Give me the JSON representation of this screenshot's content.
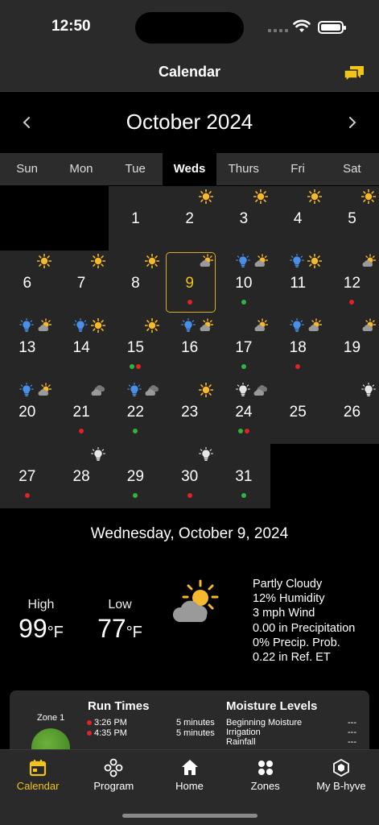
{
  "status_bar": {
    "time": "12:50"
  },
  "nav": {
    "title": "Calendar"
  },
  "calendar": {
    "month_label": "October 2024",
    "weekdays": [
      "Sun",
      "Mon",
      "Tue",
      "Weds",
      "Thurs",
      "Fri",
      "Sat"
    ],
    "active_weekday": "Weds",
    "selected_day": "9",
    "weeks": [
      [
        {
          "day": "",
          "icons": [],
          "dots": []
        },
        {
          "day": "",
          "icons": [],
          "dots": []
        },
        {
          "day": "1",
          "icons": [],
          "dots": []
        },
        {
          "day": "2",
          "icons": [
            "sun"
          ],
          "dots": []
        },
        {
          "day": "3",
          "icons": [
            "sun"
          ],
          "dots": []
        },
        {
          "day": "4",
          "icons": [
            "sun"
          ],
          "dots": []
        },
        {
          "day": "5",
          "icons": [
            "sun"
          ],
          "dots": []
        }
      ],
      [
        {
          "day": "6",
          "icons": [
            "sun"
          ],
          "dots": []
        },
        {
          "day": "7",
          "icons": [
            "sun"
          ],
          "dots": []
        },
        {
          "day": "8",
          "icons": [
            "sun"
          ],
          "dots": []
        },
        {
          "day": "9",
          "icons": [
            "partly-cloudy"
          ],
          "dots": [
            "red"
          ]
        },
        {
          "day": "10",
          "icons": [
            "blue-bulb",
            "partly-cloudy"
          ],
          "dots": [
            "green"
          ]
        },
        {
          "day": "11",
          "icons": [
            "blue-bulb",
            "sun"
          ],
          "dots": []
        },
        {
          "day": "12",
          "icons": [
            "partly-cloudy"
          ],
          "dots": [
            "red"
          ]
        }
      ],
      [
        {
          "day": "13",
          "icons": [
            "blue-bulb",
            "partly-cloudy"
          ],
          "dots": []
        },
        {
          "day": "14",
          "icons": [
            "blue-bulb",
            "sun"
          ],
          "dots": []
        },
        {
          "day": "15",
          "icons": [
            "sun"
          ],
          "dots": [
            "green",
            "red"
          ]
        },
        {
          "day": "16",
          "icons": [
            "blue-bulb",
            "partly-cloudy"
          ],
          "dots": []
        },
        {
          "day": "17",
          "icons": [
            "partly-cloudy"
          ],
          "dots": [
            "green"
          ]
        },
        {
          "day": "18",
          "icons": [
            "blue-bulb",
            "partly-cloudy"
          ],
          "dots": [
            "red"
          ]
        },
        {
          "day": "19",
          "icons": [
            "partly-cloudy"
          ],
          "dots": []
        }
      ],
      [
        {
          "day": "20",
          "icons": [
            "blue-bulb",
            "partly-cloudy"
          ],
          "dots": []
        },
        {
          "day": "21",
          "icons": [
            "cloudy"
          ],
          "dots": [
            "red"
          ]
        },
        {
          "day": "22",
          "icons": [
            "blue-bulb",
            "cloudy"
          ],
          "dots": [
            "green"
          ]
        },
        {
          "day": "23",
          "icons": [
            "sun"
          ],
          "dots": []
        },
        {
          "day": "24",
          "icons": [
            "white-bulb",
            "cloudy"
          ],
          "dots": [
            "green",
            "red"
          ]
        },
        {
          "day": "25",
          "icons": [],
          "dots": []
        },
        {
          "day": "26",
          "icons": [
            "white-bulb"
          ],
          "dots": []
        }
      ],
      [
        {
          "day": "27",
          "icons": [],
          "dots": [
            "red"
          ]
        },
        {
          "day": "28",
          "icons": [
            "white-bulb"
          ],
          "dots": []
        },
        {
          "day": "29",
          "icons": [],
          "dots": [
            "green"
          ]
        },
        {
          "day": "30",
          "icons": [
            "white-bulb"
          ],
          "dots": [
            "red"
          ]
        },
        {
          "day": "31",
          "icons": [],
          "dots": [
            "green"
          ]
        },
        {
          "day": "",
          "icons": [],
          "dots": []
        },
        {
          "day": "",
          "icons": [],
          "dots": []
        }
      ]
    ]
  },
  "selected_date_heading": "Wednesday, October 9, 2024",
  "weather": {
    "high_label": "High",
    "high_value": "99",
    "high_unit": "°F",
    "low_label": "Low",
    "low_value": "77",
    "low_unit": "°F",
    "icon": "partly-cloudy",
    "details": [
      "Partly Cloudy",
      "12% Humidity",
      "3 mph Wind",
      "0.00 in Precipitation",
      "0% Precip. Prob.",
      "0.22 in Ref. ET"
    ]
  },
  "zone_card": {
    "zone_name": "Zone 1",
    "run_times_title": "Run Times",
    "run_times": [
      {
        "time": "3:26 PM",
        "duration": "5 minutes"
      },
      {
        "time": "4:35 PM",
        "duration": "5 minutes"
      }
    ],
    "moisture_title": "Moisture Levels",
    "moisture_rows": [
      {
        "label": "Beginning Moisture",
        "value": "---"
      },
      {
        "label": "Irrigation",
        "value": "---"
      },
      {
        "label": "Rainfall",
        "value": "---"
      }
    ]
  },
  "tabs": [
    {
      "label": "Calendar",
      "icon": "calendar-icon"
    },
    {
      "label": "Program",
      "icon": "program-icon"
    },
    {
      "label": "Home",
      "icon": "home-icon"
    },
    {
      "label": "Zones",
      "icon": "zones-icon"
    },
    {
      "label": "My B-hyve",
      "icon": "bhyve-icon"
    }
  ],
  "active_tab": "Calendar",
  "colors": {
    "accent": "#f0c419",
    "dot_red": "#e02424",
    "dot_green": "#2fb344",
    "bulb_blue": "#4a8fe7",
    "sun": "#f5b82e",
    "cloud": "#9a9a9a"
  }
}
